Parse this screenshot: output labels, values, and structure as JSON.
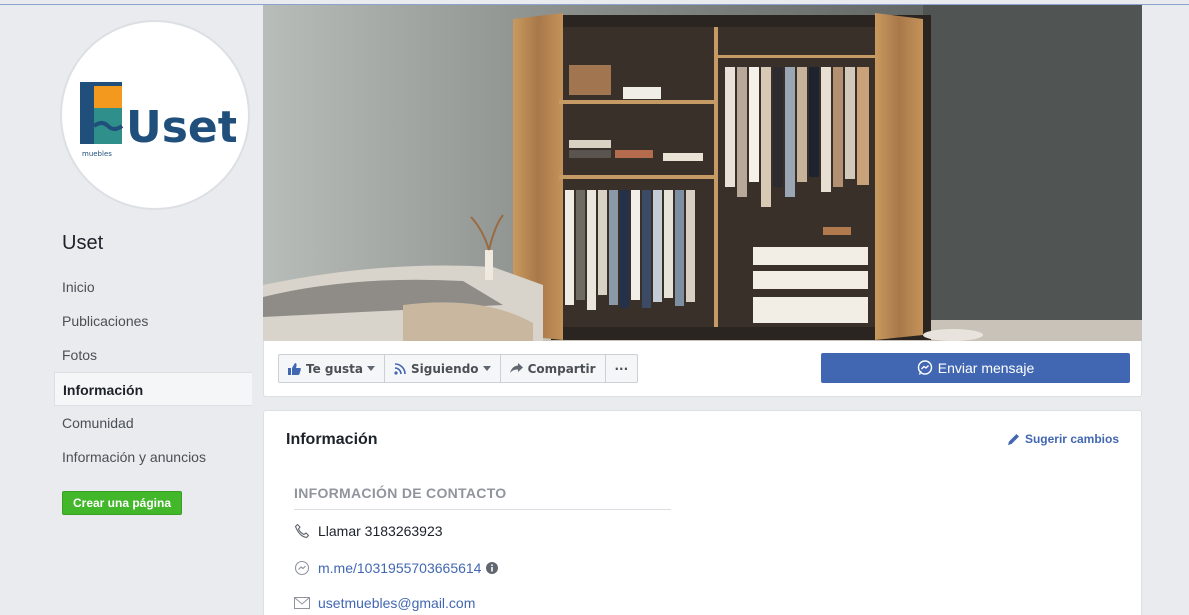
{
  "page": {
    "name": "Uset",
    "logo": {
      "word": "Uset",
      "sub": "muebles"
    }
  },
  "nav": {
    "items": [
      {
        "label": "Inicio"
      },
      {
        "label": "Publicaciones"
      },
      {
        "label": "Fotos"
      },
      {
        "label": "Información",
        "active": true
      },
      {
        "label": "Comunidad"
      },
      {
        "label": "Información y anuncios"
      }
    ],
    "create_page": "Crear una página"
  },
  "actions": {
    "like": "Te gusta",
    "following": "Siguiendo",
    "share": "Compartir",
    "more": "···",
    "message": "Enviar mensaje"
  },
  "info": {
    "title": "Información",
    "suggest": "Sugerir cambios",
    "contact_header": "INFORMACIÓN DE CONTACTO",
    "phone": "Llamar 3183263923",
    "messenger": "m.me/1031955703665614",
    "email": "usetmuebles@gmail.com"
  },
  "colors": {
    "brand_blue": "#4267b2",
    "green": "#42b72a",
    "logo_blue": "#1f4f7a",
    "logo_orange": "#f39a1e",
    "logo_teal": "#2f8f8a"
  },
  "icons": [
    "thumbs-up-icon",
    "rss-icon",
    "share-arrow-icon",
    "messenger-icon",
    "pencil-icon",
    "phone-icon",
    "envelope-icon",
    "info-circle-icon"
  ]
}
